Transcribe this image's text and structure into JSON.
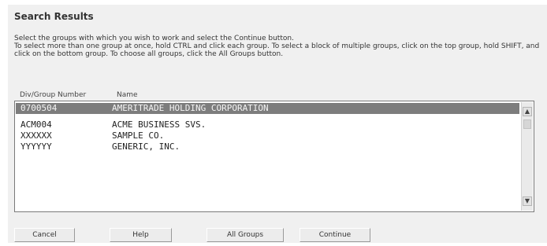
{
  "header": {
    "title": "Search Results"
  },
  "instructions": {
    "line1": "Select the groups with which you wish to work and select the Continue button.",
    "line2": "To select more than one group at once, hold CTRL and click each group. To select a block of multiple groups, click on the top group, hold SHIFT, and click on the bottom group. To choose all groups, click the All Groups button."
  },
  "list": {
    "column_headers": {
      "div_group_number": "Div/Group Number",
      "name": "Name"
    },
    "rows": [
      {
        "id": "0700504",
        "name": "AMERITRADE HOLDING CORPORATION",
        "selected": true
      },
      {
        "id": "ACM004",
        "name": "ACME BUSINESS SVS.",
        "selected": false
      },
      {
        "id": "XXXXXX",
        "name": "SAMPLE CO.",
        "selected": false
      },
      {
        "id": "YYYYYY",
        "name": "GENERIC, INC.",
        "selected": false
      }
    ],
    "scroll_up_icon": "triangle-up",
    "scroll_down_icon": "triangle-down"
  },
  "buttons": {
    "cancel": "Cancel",
    "help": "Help",
    "all_groups": "All Groups",
    "continue": "Continue"
  },
  "colors": {
    "panel_background": "#f0f0f0",
    "selected_row": "#7d7d7d"
  }
}
